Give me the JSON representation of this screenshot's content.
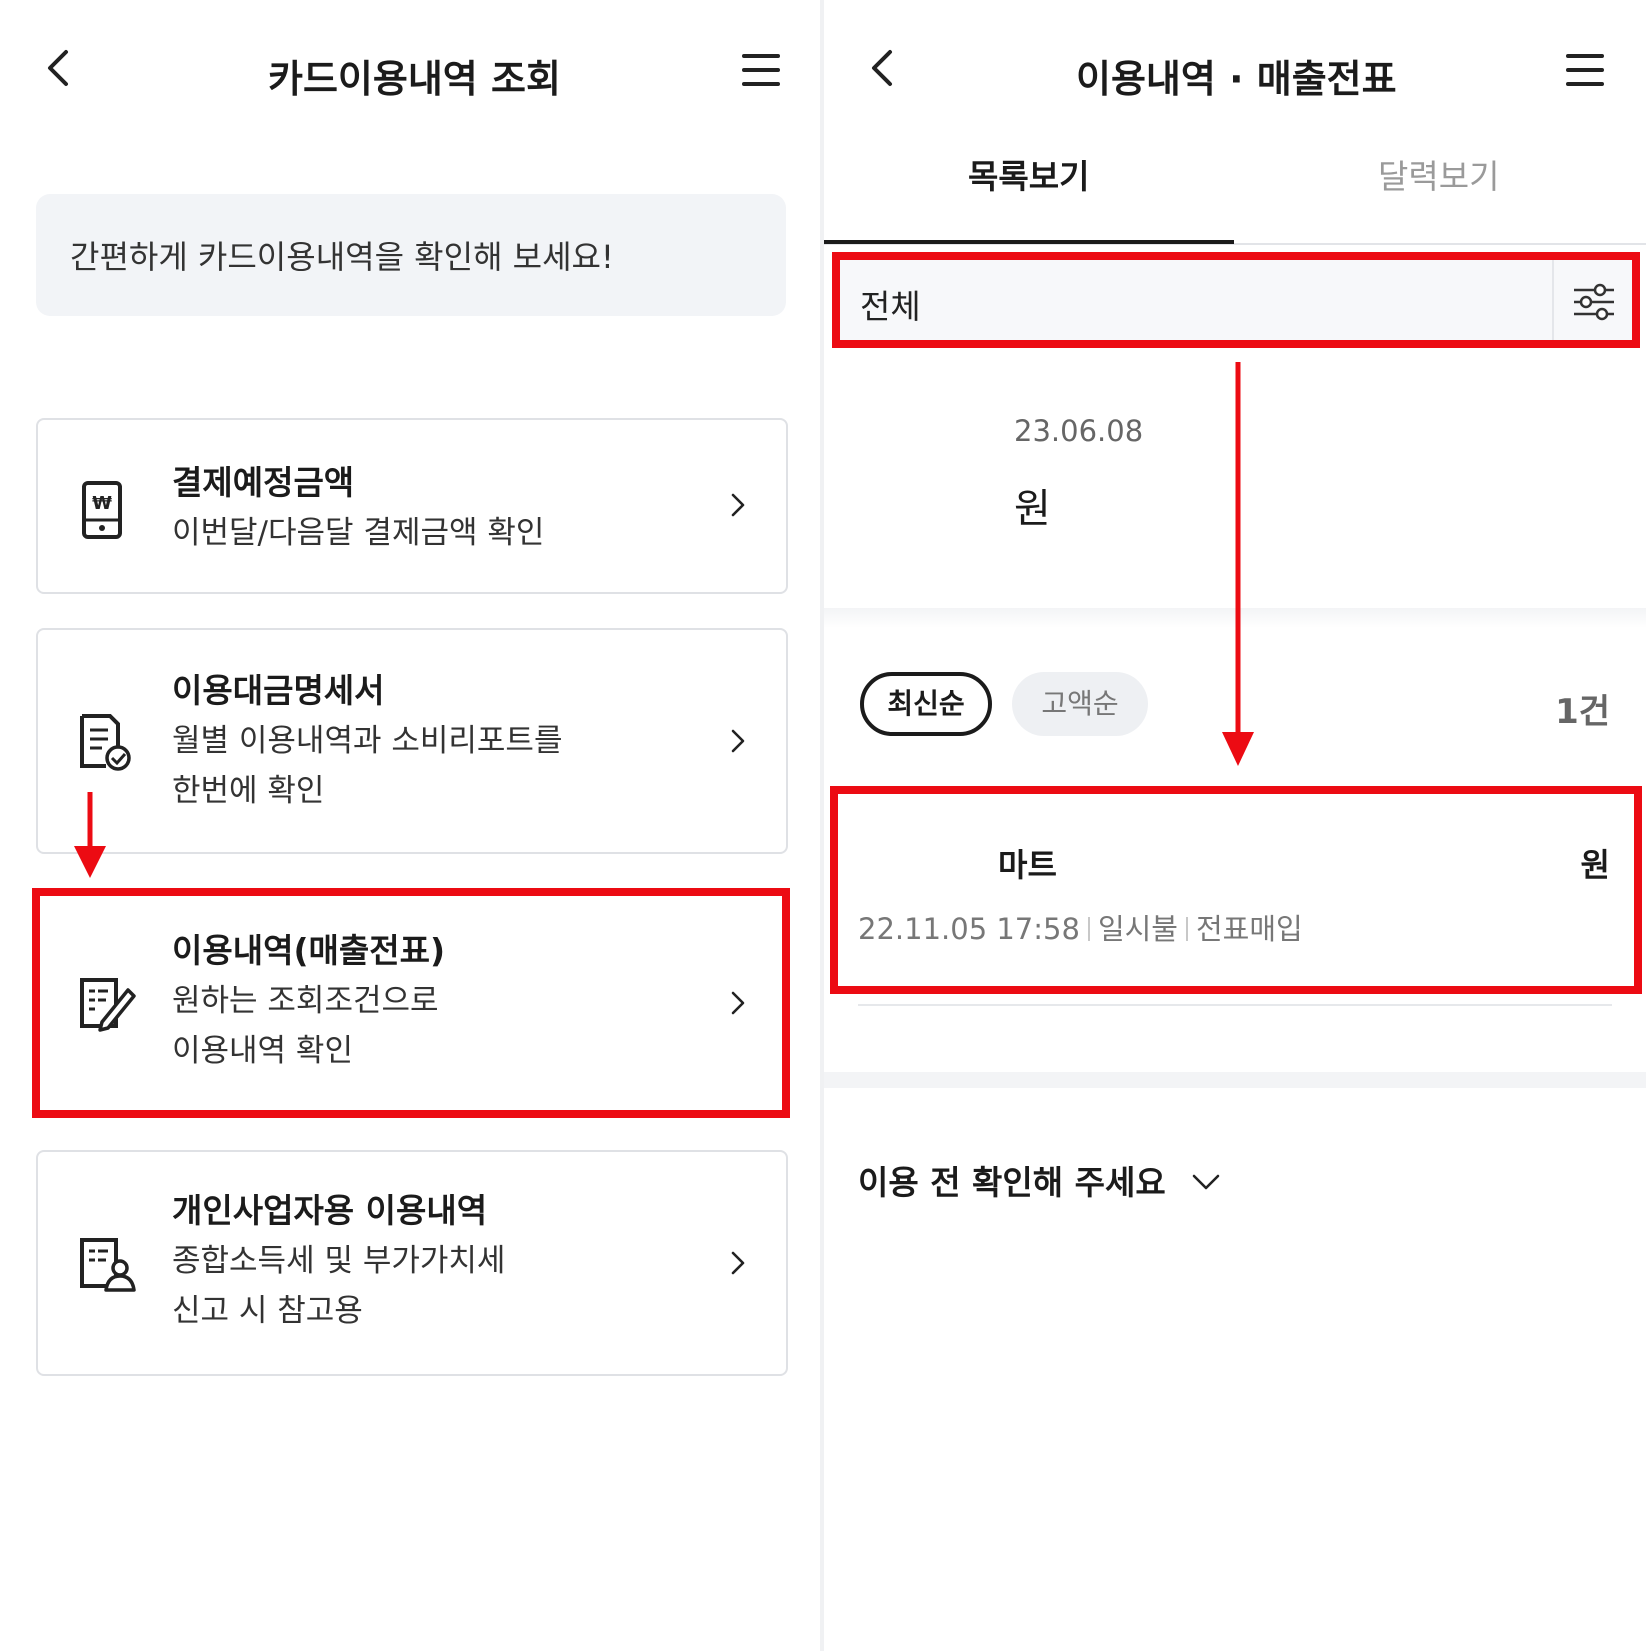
{
  "left": {
    "header": {
      "title": "카드이용내역 조회",
      "back_icon": "chevron-left-icon",
      "menu_icon": "hamburger-icon"
    },
    "banner": {
      "text": "간편하게 카드이용내역을 확인해 보세요!"
    },
    "cards": [
      {
        "title": "결제예정금액",
        "desc1": "이번달/다음달 결제금액 확인",
        "desc2": "",
        "icon": "phone-won-icon"
      },
      {
        "title": "이용대금명세서",
        "desc1": "월별 이용내역과 소비리포트를",
        "desc2": "한번에 확인",
        "icon": "statement-check-icon"
      },
      {
        "title": "이용내역(매출전표)",
        "desc1": "원하는 조회조건으로",
        "desc2": "이용내역 확인",
        "icon": "document-pen-icon"
      },
      {
        "title": "개인사업자용 이용내역",
        "desc1": "종합소득세 및 부가가치세",
        "desc2": "신고 시 참고용",
        "icon": "document-user-icon"
      }
    ]
  },
  "right": {
    "header": {
      "title": "이용내역 · 매출전표",
      "back_icon": "chevron-left-icon",
      "menu_icon": "hamburger-icon"
    },
    "tabs": [
      {
        "label": "목록보기",
        "active": true
      },
      {
        "label": "달력보기",
        "active": false
      }
    ],
    "filter": {
      "label": "전체",
      "icon": "filter-sliders-icon"
    },
    "summary": {
      "date": "23.06.08",
      "amount_suffix": "원"
    },
    "sort": {
      "options": [
        "최신순",
        "고액순"
      ],
      "selected": "최신순",
      "count": "1건"
    },
    "transaction": {
      "merchant": "마트",
      "amount_suffix": "원",
      "datetime": "22.11.05 17:58",
      "payment_type": "일시불",
      "status": "전표매입"
    },
    "notice": {
      "label": "이용 전 확인해 주세요",
      "icon": "chevron-down-icon"
    }
  },
  "colors": {
    "highlight": "#ec0b13",
    "accent_text": "#1b1b1b",
    "muted_text": "#777777",
    "banner_bg": "#f2f4f7"
  }
}
